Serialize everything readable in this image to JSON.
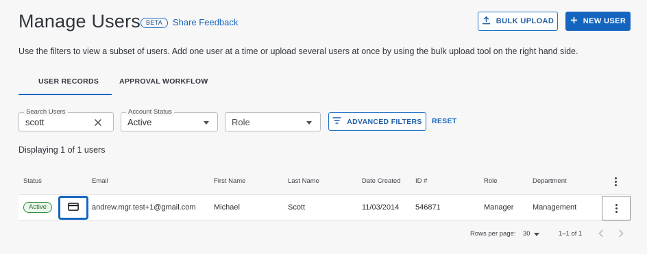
{
  "header": {
    "title": "Manage Users",
    "badge": "BETA",
    "feedback_link": "Share Feedback",
    "bulk_upload_label": "BULK UPLOAD",
    "new_user_label": "NEW USER"
  },
  "description": "Use the filters to view a subset of users. Add one user at a time or upload several users at once by using the bulk upload tool on the right hand side.",
  "tabs": [
    {
      "label": "USER RECORDS",
      "active": true
    },
    {
      "label": "APPROVAL WORKFLOW",
      "active": false
    }
  ],
  "filters": {
    "search": {
      "label": "Search Users",
      "value": "scott"
    },
    "account_status": {
      "label": "Account Status",
      "value": "Active"
    },
    "role": {
      "placeholder": "Role"
    },
    "advanced_label": "ADVANCED FILTERS",
    "reset_label": "RESET"
  },
  "summary": "Displaying 1 of 1 users",
  "table": {
    "columns": [
      "Status",
      "Email",
      "First Name",
      "Last Name",
      "Date Created",
      "ID #",
      "Role",
      "Department"
    ],
    "rows": [
      {
        "status": "Active",
        "email": "andrew.mgr.test+1@gmail.com",
        "first_name": "Michael",
        "last_name": "Scott",
        "date_created": "11/03/2014",
        "id": "546871",
        "role": "Manager",
        "department": "Management"
      }
    ]
  },
  "pagination": {
    "rows_per_page_label": "Rows per page:",
    "rows_per_page": "30",
    "range": "1–1 of 1"
  },
  "colors": {
    "accent": "#1565c0",
    "status_active": "#2f8a3e"
  },
  "icons": [
    "upload-icon",
    "plus-icon",
    "clear-icon",
    "filter-icon",
    "card-icon",
    "more-vert-icon",
    "chevron-left-icon",
    "chevron-right-icon"
  ]
}
